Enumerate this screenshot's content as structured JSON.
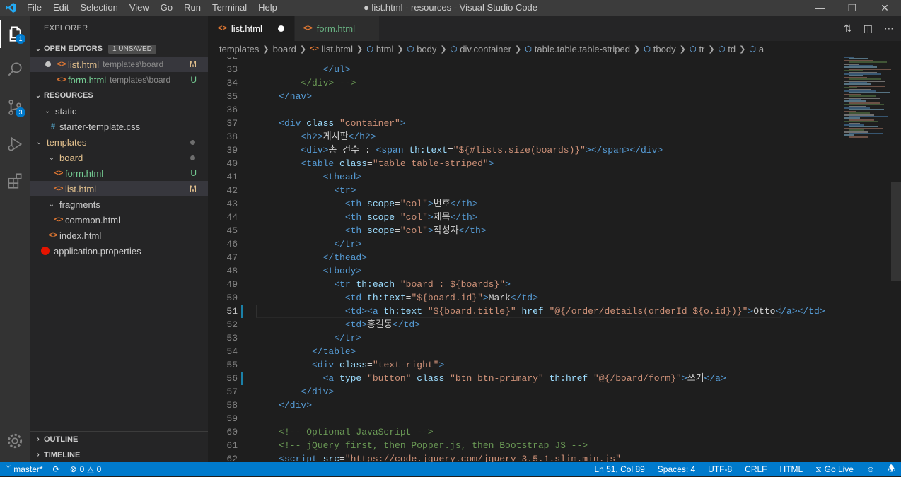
{
  "window": {
    "title": "● list.html - resources - Visual Studio Code"
  },
  "menu": [
    "File",
    "Edit",
    "Selection",
    "View",
    "Go",
    "Run",
    "Terminal",
    "Help"
  ],
  "activity": {
    "explorer_badge": "1",
    "scm_badge": "3"
  },
  "explorer": {
    "title": "EXPLORER",
    "open_editors": {
      "label": "OPEN EDITORS",
      "badge": "1 UNSAVED",
      "items": [
        {
          "name": "list.html",
          "path": "templates\\board",
          "status": "M"
        },
        {
          "name": "form.html",
          "path": "templates\\board",
          "status": "U"
        }
      ]
    },
    "resources": {
      "label": "RESOURCES",
      "tree": [
        {
          "label": "static"
        },
        {
          "label": "starter-template.css"
        },
        {
          "label": "templates"
        },
        {
          "label": "board"
        },
        {
          "label": "form.html",
          "status": "U"
        },
        {
          "label": "list.html",
          "status": "M"
        },
        {
          "label": "fragments"
        },
        {
          "label": "common.html"
        },
        {
          "label": "index.html"
        },
        {
          "label": "application.properties"
        }
      ]
    },
    "outline": "OUTLINE",
    "timeline": "TIMELINE"
  },
  "tabs": [
    {
      "label": "list.html"
    },
    {
      "label": "form.html"
    }
  ],
  "breadcrumb": [
    "templates",
    "board",
    "list.html",
    "html",
    "body",
    "div.container",
    "table.table.table-striped",
    "tbody",
    "tr",
    "td",
    "a"
  ],
  "code_lines": [
    {
      "n": "32",
      "segs": []
    },
    {
      "n": "33",
      "segs": [
        {
          "c": "tg",
          "t": "            </ul>"
        }
      ]
    },
    {
      "n": "34",
      "segs": [
        {
          "c": "cm",
          "t": "        </div> -->"
        }
      ]
    },
    {
      "n": "35",
      "segs": [
        {
          "c": "tg",
          "t": "    </nav>"
        }
      ]
    },
    {
      "n": "36",
      "segs": []
    },
    {
      "n": "37",
      "segs": [
        {
          "c": "tg",
          "t": "    <div "
        },
        {
          "c": "at",
          "t": "class"
        },
        {
          "c": "tx",
          "t": "="
        },
        {
          "c": "sv",
          "t": "\"container\""
        },
        {
          "c": "tg",
          "t": ">"
        }
      ]
    },
    {
      "n": "38",
      "segs": [
        {
          "c": "tg",
          "t": "        <h2>"
        },
        {
          "c": "tx",
          "t": "게시판"
        },
        {
          "c": "tg",
          "t": "</h2>"
        }
      ]
    },
    {
      "n": "39",
      "segs": [
        {
          "c": "tg",
          "t": "        <div>"
        },
        {
          "c": "tx",
          "t": "총 건수 : "
        },
        {
          "c": "tg",
          "t": "<span "
        },
        {
          "c": "at",
          "t": "th:text"
        },
        {
          "c": "tx",
          "t": "="
        },
        {
          "c": "sv",
          "t": "\"${#lists.size(boards)}\""
        },
        {
          "c": "tg",
          "t": "></span></div>"
        }
      ]
    },
    {
      "n": "40",
      "segs": [
        {
          "c": "tg",
          "t": "        <table "
        },
        {
          "c": "at",
          "t": "class"
        },
        {
          "c": "tx",
          "t": "="
        },
        {
          "c": "sv",
          "t": "\"table table-striped\""
        },
        {
          "c": "tg",
          "t": ">"
        }
      ]
    },
    {
      "n": "41",
      "segs": [
        {
          "c": "tg",
          "t": "            <thead>"
        }
      ]
    },
    {
      "n": "42",
      "segs": [
        {
          "c": "tg",
          "t": "              <tr>"
        }
      ]
    },
    {
      "n": "43",
      "segs": [
        {
          "c": "tg",
          "t": "                <th "
        },
        {
          "c": "at",
          "t": "scope"
        },
        {
          "c": "tx",
          "t": "="
        },
        {
          "c": "sv",
          "t": "\"col\""
        },
        {
          "c": "tg",
          "t": ">"
        },
        {
          "c": "tx",
          "t": "번호"
        },
        {
          "c": "tg",
          "t": "</th>"
        }
      ]
    },
    {
      "n": "44",
      "segs": [
        {
          "c": "tg",
          "t": "                <th "
        },
        {
          "c": "at",
          "t": "scope"
        },
        {
          "c": "tx",
          "t": "="
        },
        {
          "c": "sv",
          "t": "\"col\""
        },
        {
          "c": "tg",
          "t": ">"
        },
        {
          "c": "tx",
          "t": "제목"
        },
        {
          "c": "tg",
          "t": "</th>"
        }
      ]
    },
    {
      "n": "45",
      "segs": [
        {
          "c": "tg",
          "t": "                <th "
        },
        {
          "c": "at",
          "t": "scope"
        },
        {
          "c": "tx",
          "t": "="
        },
        {
          "c": "sv",
          "t": "\"col\""
        },
        {
          "c": "tg",
          "t": ">"
        },
        {
          "c": "tx",
          "t": "작성자"
        },
        {
          "c": "tg",
          "t": "</th>"
        }
      ]
    },
    {
      "n": "46",
      "segs": [
        {
          "c": "tg",
          "t": "              </tr>"
        }
      ]
    },
    {
      "n": "47",
      "segs": [
        {
          "c": "tg",
          "t": "            </thead>"
        }
      ]
    },
    {
      "n": "48",
      "segs": [
        {
          "c": "tg",
          "t": "            <tbody>"
        }
      ]
    },
    {
      "n": "49",
      "segs": [
        {
          "c": "tg",
          "t": "              <tr "
        },
        {
          "c": "at",
          "t": "th:each"
        },
        {
          "c": "tx",
          "t": "="
        },
        {
          "c": "sv",
          "t": "\"board : ${boards}\""
        },
        {
          "c": "tg",
          "t": ">"
        }
      ]
    },
    {
      "n": "50",
      "segs": [
        {
          "c": "tg",
          "t": "                <td "
        },
        {
          "c": "at",
          "t": "th:text"
        },
        {
          "c": "tx",
          "t": "="
        },
        {
          "c": "sv",
          "t": "\"${board.id}\""
        },
        {
          "c": "tg",
          "t": ">"
        },
        {
          "c": "tx",
          "t": "Mark"
        },
        {
          "c": "tg",
          "t": "</td>"
        }
      ]
    },
    {
      "n": "51",
      "segs": [
        {
          "c": "tg",
          "t": "                <td><a "
        },
        {
          "c": "at",
          "t": "th:text"
        },
        {
          "c": "tx",
          "t": "="
        },
        {
          "c": "sv",
          "t": "\"${board.title}\""
        },
        {
          "c": "tx",
          "t": " "
        },
        {
          "c": "at",
          "t": "href"
        },
        {
          "c": "tx",
          "t": "="
        },
        {
          "c": "sv",
          "t": "\"@{/order/details(orderId=${o.id})}\""
        },
        {
          "c": "tg",
          "t": ">"
        },
        {
          "c": "tx",
          "t": "Otto"
        },
        {
          "c": "tg",
          "t": "</a></td>"
        }
      ]
    },
    {
      "n": "52",
      "segs": [
        {
          "c": "tg",
          "t": "                <td>"
        },
        {
          "c": "tx",
          "t": "홍길동"
        },
        {
          "c": "tg",
          "t": "</td>"
        }
      ]
    },
    {
      "n": "53",
      "segs": [
        {
          "c": "tg",
          "t": "              </tr>"
        }
      ]
    },
    {
      "n": "54",
      "segs": [
        {
          "c": "tg",
          "t": "          </table>"
        }
      ]
    },
    {
      "n": "55",
      "segs": [
        {
          "c": "tg",
          "t": "          <div "
        },
        {
          "c": "at",
          "t": "class"
        },
        {
          "c": "tx",
          "t": "="
        },
        {
          "c": "sv",
          "t": "\"text-right\""
        },
        {
          "c": "tg",
          "t": ">"
        }
      ]
    },
    {
      "n": "56",
      "segs": [
        {
          "c": "tg",
          "t": "            <a "
        },
        {
          "c": "at",
          "t": "type"
        },
        {
          "c": "tx",
          "t": "="
        },
        {
          "c": "sv",
          "t": "\"button\""
        },
        {
          "c": "tx",
          "t": " "
        },
        {
          "c": "at",
          "t": "class"
        },
        {
          "c": "tx",
          "t": "="
        },
        {
          "c": "sv",
          "t": "\"btn btn-primary\""
        },
        {
          "c": "tx",
          "t": " "
        },
        {
          "c": "at",
          "t": "th:href"
        },
        {
          "c": "tx",
          "t": "="
        },
        {
          "c": "sv",
          "t": "\"@{/board/form}\""
        },
        {
          "c": "tg",
          "t": ">"
        },
        {
          "c": "tx",
          "t": "쓰기"
        },
        {
          "c": "tg",
          "t": "</a>"
        }
      ]
    },
    {
      "n": "57",
      "segs": [
        {
          "c": "tg",
          "t": "        </div>"
        }
      ]
    },
    {
      "n": "58",
      "segs": [
        {
          "c": "tg",
          "t": "    </div>"
        }
      ]
    },
    {
      "n": "59",
      "segs": []
    },
    {
      "n": "60",
      "segs": [
        {
          "c": "cm",
          "t": "    <!-- Optional JavaScript -->"
        }
      ]
    },
    {
      "n": "61",
      "segs": [
        {
          "c": "cm",
          "t": "    <!-- jQuery first, then Popper.js, then Bootstrap JS -->"
        }
      ]
    },
    {
      "n": "62",
      "segs": [
        {
          "c": "tg",
          "t": "    <script "
        },
        {
          "c": "at",
          "t": "src"
        },
        {
          "c": "tx",
          "t": "="
        },
        {
          "c": "sv",
          "t": "\"https://code.jquery.com/jquery-3.5.1.slim.min.js\""
        }
      ]
    }
  ],
  "status": {
    "branch": "master*",
    "errors": "0",
    "warnings": "0",
    "position": "Ln 51, Col 89",
    "spaces": "Spaces: 4",
    "encoding": "UTF-8",
    "eol": "CRLF",
    "language": "HTML",
    "golive": "Go Live"
  }
}
